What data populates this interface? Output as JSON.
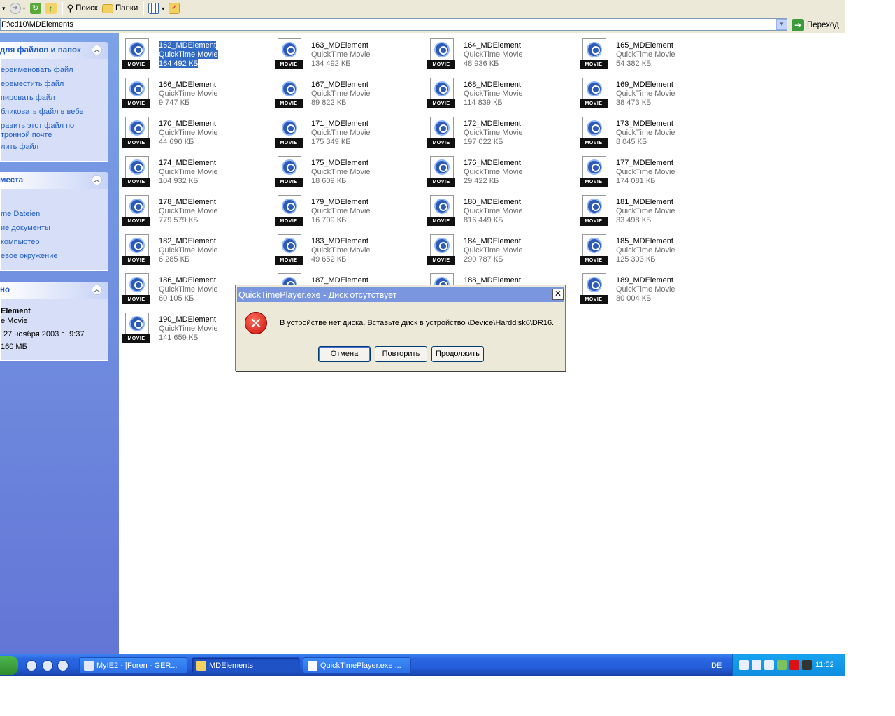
{
  "toolbar": {
    "search_label": "Поиск",
    "folders_label": "Папки"
  },
  "address": {
    "path": "F:\\cd10\\MDElements",
    "go_label": "Переход"
  },
  "tasks_panel": {
    "title": "для файлов и папок",
    "links": [
      "ереименовать файл",
      "ереместить файл",
      "пировать файл",
      "бликовать файл в вебе",
      "равить этот файл по",
      "тронной почте",
      "лить файл"
    ]
  },
  "places_panel": {
    "title": "места",
    "links": [
      "me Dateien",
      "ие документы",
      "компьютер",
      "евое окружение"
    ]
  },
  "details_panel": {
    "title": "но",
    "name": "Element",
    "type": "e Movie",
    "date": "27 ноября 2003 г., 9:37",
    "size": "160 МБ"
  },
  "files": [
    {
      "name": "162_MDElement",
      "type": "QuickTime Movie",
      "size": "164 492 КБ"
    },
    {
      "name": "163_MDElement",
      "type": "QuickTime Movie",
      "size": "134 492 КБ"
    },
    {
      "name": "164_MDElement",
      "type": "QuickTime Movie",
      "size": "48 936 КБ"
    },
    {
      "name": "165_MDElement",
      "type": "QuickTime Movie",
      "size": "54 382 КБ"
    },
    {
      "name": "166_MDElement",
      "type": "QuickTime Movie",
      "size": "9 747 КБ"
    },
    {
      "name": "167_MDElement",
      "type": "QuickTime Movie",
      "size": "89 822 КБ"
    },
    {
      "name": "168_MDElement",
      "type": "QuickTime Movie",
      "size": "114 839 КБ"
    },
    {
      "name": "169_MDElement",
      "type": "QuickTime Movie",
      "size": "38 473 КБ"
    },
    {
      "name": "170_MDElement",
      "type": "QuickTime Movie",
      "size": "44 690 КБ"
    },
    {
      "name": "171_MDElement",
      "type": "QuickTime Movie",
      "size": "175 349 КБ"
    },
    {
      "name": "172_MDElement",
      "type": "QuickTime Movie",
      "size": "197 022 КБ"
    },
    {
      "name": "173_MDElement",
      "type": "QuickTime Movie",
      "size": "8 045 КБ"
    },
    {
      "name": "174_MDElement",
      "type": "QuickTime Movie",
      "size": "104 932 КБ"
    },
    {
      "name": "175_MDElement",
      "type": "QuickTime Movie",
      "size": "18 609 КБ"
    },
    {
      "name": "176_MDElement",
      "type": "QuickTime Movie",
      "size": "29 422 КБ"
    },
    {
      "name": "177_MDElement",
      "type": "QuickTime Movie",
      "size": "174 081 КБ"
    },
    {
      "name": "178_MDElement",
      "type": "QuickTime Movie",
      "size": "779 579 КБ"
    },
    {
      "name": "179_MDElement",
      "type": "QuickTime Movie",
      "size": "16 709 КБ"
    },
    {
      "name": "180_MDElement",
      "type": "QuickTime Movie",
      "size": "816 449 КБ"
    },
    {
      "name": "181_MDElement",
      "type": "QuickTime Movie",
      "size": "33 498 КБ"
    },
    {
      "name": "182_MDElement",
      "type": "QuickTime Movie",
      "size": "6 285 КБ"
    },
    {
      "name": "183_MDElement",
      "type": "QuickTime Movie",
      "size": "49 652 КБ"
    },
    {
      "name": "184_MDElement",
      "type": "QuickTime Movie",
      "size": "290 787 КБ"
    },
    {
      "name": "185_MDElement",
      "type": "QuickTime Movie",
      "size": "125 303 КБ"
    },
    {
      "name": "186_MDElement",
      "type": "QuickTime Movie",
      "size": "60 105 КБ"
    },
    {
      "name": "187_MDElement",
      "type": "",
      "size": ""
    },
    {
      "name": "188_MDElement",
      "type": "",
      "size": ""
    },
    {
      "name": "189_MDElement",
      "type": "QuickTime Movie",
      "size": "80 004 КБ"
    },
    {
      "name": "190_MDElement",
      "type": "QuickTime Movie",
      "size": "141 659 КБ"
    }
  ],
  "dialog": {
    "title": "QuickTimePlayer.exe - Диск отсутствует",
    "message": "В устройстве нет диска. Вставьте диск в устройство \\Device\\Harddisk6\\DR16.",
    "btn_cancel": "Отмена",
    "btn_retry": "Повторить",
    "btn_continue": "Продолжить"
  },
  "taskbar": {
    "tasks": [
      "MyIE2 - [Foren - GER...",
      "MDElements",
      "QuickTimePlayer.exe ..."
    ],
    "language": "DE",
    "clock": "11:52"
  },
  "colors": {
    "taskbar_blue": "#245edb",
    "selection": "#316ac5",
    "link": "#215dc6",
    "dialog_title": "#7a96df"
  }
}
